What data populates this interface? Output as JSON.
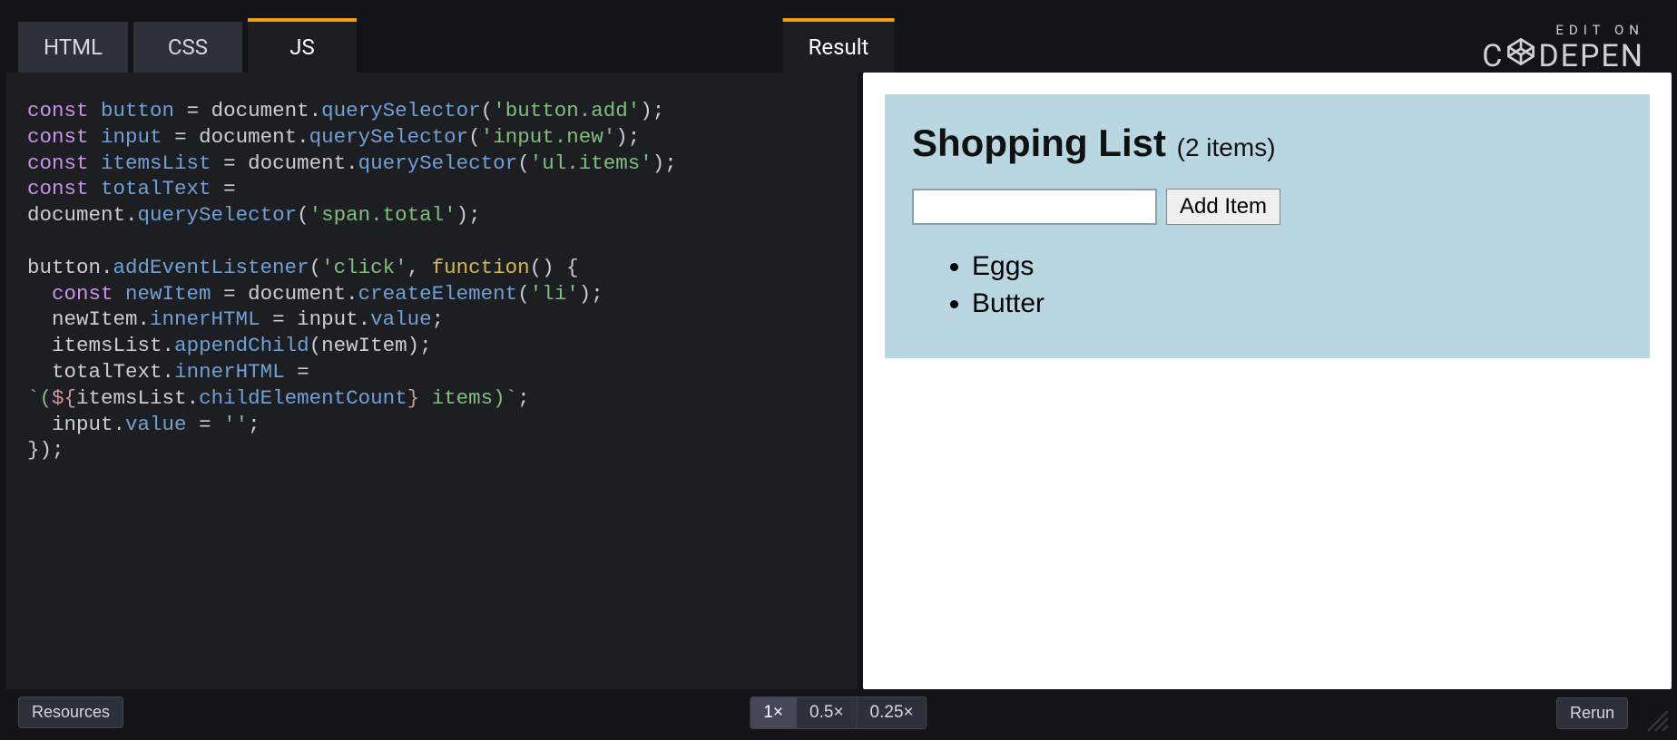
{
  "tabs": {
    "html": "HTML",
    "css": "CSS",
    "js": "JS",
    "result": "Result",
    "active": "js"
  },
  "brand": {
    "edit_on": "EDIT ON",
    "name_left": "C",
    "name_right": "DEPEN"
  },
  "code": {
    "lines": [
      [
        {
          "t": "kw",
          "v": "const"
        },
        {
          "t": "sp",
          "v": " "
        },
        {
          "t": "var",
          "v": "button"
        },
        {
          "t": "sp",
          "v": " "
        },
        {
          "t": "punc",
          "v": "="
        },
        {
          "t": "sp",
          "v": " "
        },
        {
          "t": "punc",
          "v": "document"
        },
        {
          "t": "punc",
          "v": "."
        },
        {
          "t": "fn",
          "v": "querySelector"
        },
        {
          "t": "punc",
          "v": "("
        },
        {
          "t": "str",
          "v": "'button.add'"
        },
        {
          "t": "punc",
          "v": ");"
        }
      ],
      [
        {
          "t": "kw",
          "v": "const"
        },
        {
          "t": "sp",
          "v": " "
        },
        {
          "t": "var",
          "v": "input"
        },
        {
          "t": "sp",
          "v": " "
        },
        {
          "t": "punc",
          "v": "="
        },
        {
          "t": "sp",
          "v": " "
        },
        {
          "t": "punc",
          "v": "document"
        },
        {
          "t": "punc",
          "v": "."
        },
        {
          "t": "fn",
          "v": "querySelector"
        },
        {
          "t": "punc",
          "v": "("
        },
        {
          "t": "str",
          "v": "'input.new'"
        },
        {
          "t": "punc",
          "v": ");"
        }
      ],
      [
        {
          "t": "kw",
          "v": "const"
        },
        {
          "t": "sp",
          "v": " "
        },
        {
          "t": "var",
          "v": "itemsList"
        },
        {
          "t": "sp",
          "v": " "
        },
        {
          "t": "punc",
          "v": "="
        },
        {
          "t": "sp",
          "v": " "
        },
        {
          "t": "punc",
          "v": "document"
        },
        {
          "t": "punc",
          "v": "."
        },
        {
          "t": "fn",
          "v": "querySelector"
        },
        {
          "t": "punc",
          "v": "("
        },
        {
          "t": "str",
          "v": "'ul.items'"
        },
        {
          "t": "punc",
          "v": ");"
        }
      ],
      [
        {
          "t": "kw",
          "v": "const"
        },
        {
          "t": "sp",
          "v": " "
        },
        {
          "t": "var",
          "v": "totalText"
        },
        {
          "t": "sp",
          "v": " "
        },
        {
          "t": "punc",
          "v": "="
        }
      ],
      [
        {
          "t": "punc",
          "v": "document"
        },
        {
          "t": "punc",
          "v": "."
        },
        {
          "t": "fn",
          "v": "querySelector"
        },
        {
          "t": "punc",
          "v": "("
        },
        {
          "t": "str",
          "v": "'span.total'"
        },
        {
          "t": "punc",
          "v": ");"
        }
      ],
      [],
      [
        {
          "t": "punc",
          "v": "button"
        },
        {
          "t": "punc",
          "v": "."
        },
        {
          "t": "fn",
          "v": "addEventListener"
        },
        {
          "t": "punc",
          "v": "("
        },
        {
          "t": "str",
          "v": "'click'"
        },
        {
          "t": "punc",
          "v": ", "
        },
        {
          "t": "kw2",
          "v": "function"
        },
        {
          "t": "punc",
          "v": "() {"
        }
      ],
      [
        {
          "t": "sp",
          "v": "  "
        },
        {
          "t": "kw",
          "v": "const"
        },
        {
          "t": "sp",
          "v": " "
        },
        {
          "t": "var",
          "v": "newItem"
        },
        {
          "t": "sp",
          "v": " "
        },
        {
          "t": "punc",
          "v": "="
        },
        {
          "t": "sp",
          "v": " "
        },
        {
          "t": "punc",
          "v": "document"
        },
        {
          "t": "punc",
          "v": "."
        },
        {
          "t": "fn",
          "v": "createElement"
        },
        {
          "t": "punc",
          "v": "("
        },
        {
          "t": "str",
          "v": "'li'"
        },
        {
          "t": "punc",
          "v": ");"
        }
      ],
      [
        {
          "t": "sp",
          "v": "  "
        },
        {
          "t": "punc",
          "v": "newItem"
        },
        {
          "t": "punc",
          "v": "."
        },
        {
          "t": "prop",
          "v": "innerHTML"
        },
        {
          "t": "sp",
          "v": " "
        },
        {
          "t": "punc",
          "v": "="
        },
        {
          "t": "sp",
          "v": " "
        },
        {
          "t": "punc",
          "v": "input"
        },
        {
          "t": "punc",
          "v": "."
        },
        {
          "t": "prop",
          "v": "value"
        },
        {
          "t": "punc",
          "v": ";"
        }
      ],
      [
        {
          "t": "sp",
          "v": "  "
        },
        {
          "t": "punc",
          "v": "itemsList"
        },
        {
          "t": "punc",
          "v": "."
        },
        {
          "t": "fn",
          "v": "appendChild"
        },
        {
          "t": "punc",
          "v": "("
        },
        {
          "t": "punc",
          "v": "newItem"
        },
        {
          "t": "punc",
          "v": ");"
        }
      ],
      [
        {
          "t": "sp",
          "v": "  "
        },
        {
          "t": "punc",
          "v": "totalText"
        },
        {
          "t": "punc",
          "v": "."
        },
        {
          "t": "prop",
          "v": "innerHTML"
        },
        {
          "t": "sp",
          "v": " "
        },
        {
          "t": "punc",
          "v": "="
        }
      ],
      [
        {
          "t": "tmpl",
          "v": "`("
        },
        {
          "t": "tmplpunc",
          "v": "${"
        },
        {
          "t": "punc",
          "v": "itemsList"
        },
        {
          "t": "punc",
          "v": "."
        },
        {
          "t": "prop",
          "v": "childElementCount"
        },
        {
          "t": "tmplpunc",
          "v": "}"
        },
        {
          "t": "tmpl",
          "v": " items)`"
        },
        {
          "t": "punc",
          "v": ";"
        }
      ],
      [
        {
          "t": "sp",
          "v": "  "
        },
        {
          "t": "punc",
          "v": "input"
        },
        {
          "t": "punc",
          "v": "."
        },
        {
          "t": "prop",
          "v": "value"
        },
        {
          "t": "sp",
          "v": " "
        },
        {
          "t": "punc",
          "v": "="
        },
        {
          "t": "sp",
          "v": " "
        },
        {
          "t": "str",
          "v": "''"
        },
        {
          "t": "punc",
          "v": ";"
        }
      ],
      [
        {
          "t": "punc",
          "v": "});"
        }
      ]
    ]
  },
  "result": {
    "title": "Shopping List",
    "count_text": "(2 items)",
    "add_button": "Add Item",
    "input_value": "",
    "items": [
      "Eggs",
      "Butter"
    ]
  },
  "bottom": {
    "resources": "Resources",
    "zoom": [
      "1×",
      "0.5×",
      "0.25×"
    ],
    "zoom_active": 0,
    "rerun": "Rerun"
  }
}
